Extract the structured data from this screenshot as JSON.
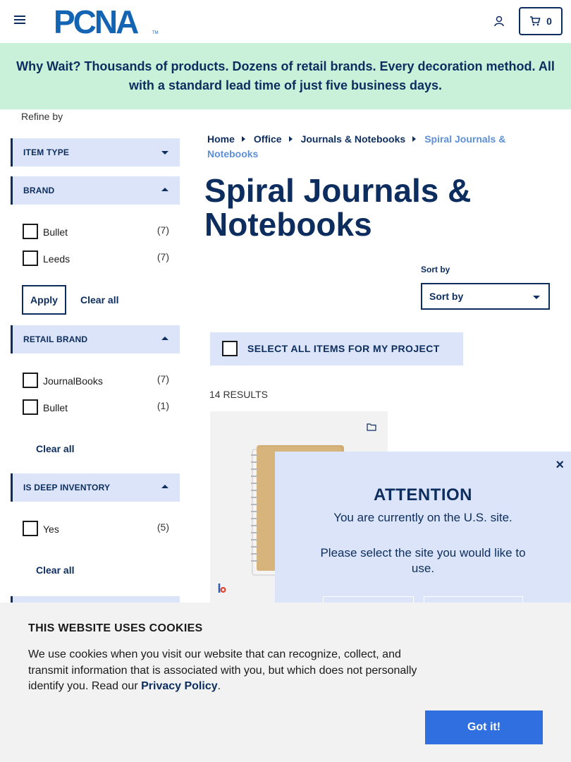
{
  "header": {
    "logo_text": "PCNA",
    "cart_count": "0",
    "brand_color": "#0c2d5e"
  },
  "promo": {
    "text": "Why Wait? Thousands of products. Dozens of retail brands. Every decoration method. All with a standard lead time of just five business days.",
    "background": "#c9f1d9"
  },
  "sidebar": {
    "refine_label": "Refine by",
    "facets": {
      "item_type": {
        "label": "ITEM TYPE"
      },
      "brand": {
        "label": "BRAND",
        "options": [
          {
            "label": "Bullet",
            "count": "(7)"
          },
          {
            "label": "Leeds",
            "count": "(7)"
          }
        ],
        "apply_label": "Apply",
        "clear_label": "Clear all"
      },
      "retail_brand": {
        "label": "RETAIL BRAND",
        "options": [
          {
            "label": "JournalBooks",
            "count": "(7)"
          },
          {
            "label": "Bullet",
            "count": "(1)"
          }
        ],
        "clear_label": "Clear all"
      },
      "deep_inventory": {
        "label": "IS DEEP INVENTORY",
        "options": [
          {
            "label": "Yes",
            "count": "(5)"
          }
        ],
        "clear_label": "Clear all"
      }
    }
  },
  "breadcrumb": {
    "items": [
      "Home",
      "Office",
      "Journals & Notebooks"
    ],
    "current": "Spiral Journals & Notebooks"
  },
  "page": {
    "title": "Spiral Journals & Notebooks",
    "sort_label": "Sort by",
    "sort_value": "Sort by",
    "select_all_label": "SELECT ALL ITEMS FOR MY PROJECT",
    "results_text": "14 RESULTS"
  },
  "modal": {
    "title": "ATTENTION",
    "line1": "You are currently on the U.S. site.",
    "line2": "Please select the site you would like to use.",
    "close_symbol": "×"
  },
  "cookie": {
    "title": "THIS WEBSITE USES COOKIES",
    "body": "We use cookies when you visit our website that can recognize, collect, and transmit information that is associated with you, but which does not personally identify you. Read our ",
    "link": "Privacy Policy",
    "suffix": ".",
    "button": "Got it!",
    "button_color": "#2f6fe0"
  }
}
